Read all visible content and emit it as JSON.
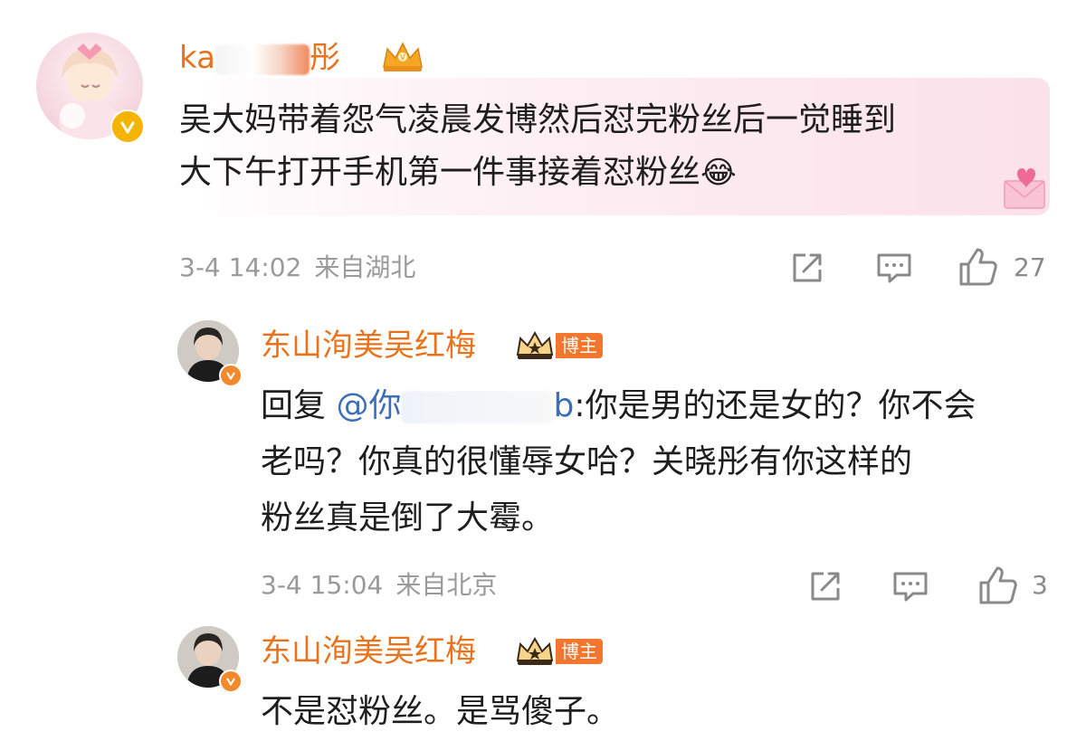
{
  "colors": {
    "username": "#e8731c",
    "mention": "#3d6fb8",
    "meta": "#9a9a9a",
    "blogger_badge": "#f2762e",
    "verify_badge": "#f5b400"
  },
  "comments": [
    {
      "user": {
        "name_prefix": "ka",
        "name_suffix": "彤",
        "badge_icon": "crown-vip-icon"
      },
      "text_line1": "吴大妈带着怨气凌晨发博然后怼完粉丝后一觉睡到",
      "text_line2": "大下午打开手机第一件事接着怼粉丝",
      "emoji": "😂",
      "time": "3-4 14:02",
      "location": "来自湖北",
      "likes": "27"
    },
    {
      "user": {
        "name": "东山洵美吴红梅",
        "role_badge": "博主",
        "badge_icon": "crown-icon"
      },
      "reply_prefix": "回复",
      "mention_visible_start": "@你",
      "mention_visible_end": "b",
      "text_line1_rest": ":你是男的还是女的？你不会",
      "text_line2": "老吗？你真的很懂辱女哈？关晓彤有你这样的",
      "text_line3": "粉丝真是倒了大霉。",
      "time": "3-4 15:04",
      "location": "来自北京",
      "likes": "3"
    },
    {
      "user": {
        "name": "东山洵美吴红梅",
        "role_badge": "博主",
        "badge_icon": "crown-icon"
      },
      "text_line1": "不是怼粉丝。是骂傻子。"
    }
  ]
}
